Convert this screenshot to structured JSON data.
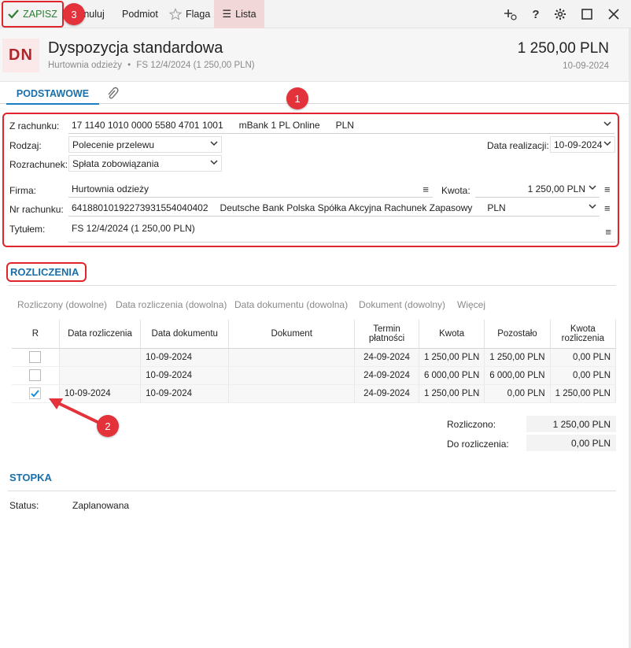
{
  "toolbar": {
    "save_label": "ZAPISZ",
    "cancel_label": "Anuluj",
    "contractor_label": "Podmiot",
    "flag_label": "Flaga",
    "list_label": "Lista"
  },
  "header": {
    "badge": "DN",
    "title": "Dyspozycja standardowa",
    "subtitle_company": "Hurtownia odzieży",
    "subtitle_doc": "FS 12/4/2024 (1 250,00 PLN)",
    "amount": "1 250,00 PLN",
    "date": "10-09-2024"
  },
  "tabs": {
    "main": "PODSTAWOWE"
  },
  "form": {
    "account_label": "Z rachunku:",
    "account_number": "17 1140 1010 0000 5580 4701 1001",
    "account_bank": "mBank 1 PL Online",
    "account_currency": "PLN",
    "type_label": "Rodzaj:",
    "type_value": "Polecenie przelewu",
    "exec_date_label": "Data realizacji:",
    "exec_date_value": "10-09-2024",
    "settlement_label": "Rozrachunek:",
    "settlement_value": "Spłata zobowiązania",
    "company_label": "Firma:",
    "company_value": "Hurtownia odzieży",
    "amount_label": "Kwota:",
    "amount_value": "1 250,00 PLN",
    "nr_label": "Nr rachunku:",
    "nr_value": "64188010192273931554040402",
    "nr_bank": "Deutsche Bank Polska Spółka Akcyjna Rachunek Zapasowy",
    "nr_currency": "PLN",
    "title_label": "Tytułem:",
    "title_value": "FS 12/4/2024 (1 250,00 PLN)"
  },
  "annotations": {
    "one": "1",
    "two": "2",
    "three": "3"
  },
  "settlements": {
    "section_title": "ROZLICZENIA",
    "filters": [
      "Rozliczony (dowolne)",
      "Data rozliczenia (dowolna)",
      "Data dokumentu (dowolna)",
      "Dokument (dowolny)",
      "Więcej"
    ],
    "columns": [
      "R",
      "Data rozliczenia",
      "Data dokumentu",
      "Dokument",
      "Termin płatności",
      "Kwota",
      "Pozostało",
      "Kwota rozliczenia"
    ],
    "rows": [
      {
        "checked": false,
        "settle_date": "",
        "doc_date": "10-09-2024",
        "doc": "",
        "due": "24-09-2024",
        "amount": "1 250,00 PLN",
        "remaining": "1 250,00 PLN",
        "settle_amount": "0,00 PLN"
      },
      {
        "checked": false,
        "settle_date": "",
        "doc_date": "10-09-2024",
        "doc": "",
        "due": "24-09-2024",
        "amount": "6 000,00 PLN",
        "remaining": "6 000,00 PLN",
        "settle_amount": "0,00 PLN"
      },
      {
        "checked": true,
        "settle_date": "10-09-2024",
        "doc_date": "10-09-2024",
        "doc": "",
        "due": "24-09-2024",
        "amount": "1 250,00 PLN",
        "remaining": "0,00 PLN",
        "settle_amount": "1 250,00 PLN"
      }
    ],
    "settled_label": "Rozliczono:",
    "settled_value": "1 250,00 PLN",
    "remaining_label": "Do rozliczenia:",
    "remaining_value": "0,00 PLN"
  },
  "footer": {
    "section_title": "STOPKA",
    "status_label": "Status:",
    "status_value": "Zaplanowana"
  },
  "colors": {
    "accent": "#1a6fa8",
    "annotation": "#e3323a",
    "save": "#2e7d32"
  }
}
